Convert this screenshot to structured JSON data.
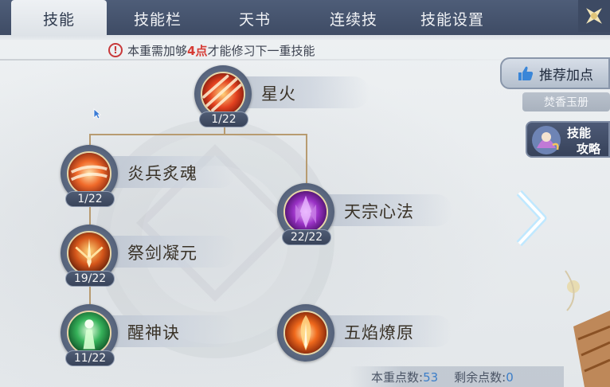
{
  "tabs": [
    {
      "label": "技能",
      "active": true
    },
    {
      "label": "技能栏",
      "active": false
    },
    {
      "label": "天书",
      "active": false
    },
    {
      "label": "连续技",
      "active": false
    },
    {
      "label": "技能设置",
      "active": false
    }
  ],
  "warning": {
    "prefix": "本重需加够",
    "highlight": "4点",
    "suffix": "才能修习下一重技能"
  },
  "skills": [
    {
      "name": "星火",
      "level": "1/22",
      "icon": "fire-slash-icon"
    },
    {
      "name": "炎兵炙魂",
      "level": "1/22",
      "icon": "flame-swirl-icon"
    },
    {
      "name": "天宗心法",
      "level": "22/22",
      "icon": "purple-crystal-icon"
    },
    {
      "name": "祭剑凝元",
      "level": "19/22",
      "icon": "sword-aura-icon"
    },
    {
      "name": "醒神诀",
      "level": "11/22",
      "icon": "green-spirit-icon"
    },
    {
      "name": "五焰燎原",
      "level": "",
      "icon": "fire-pillar-icon"
    }
  ],
  "right_panel": {
    "recommend_label": "推荐加点",
    "incense_label": "焚香玉册",
    "guide_line1": "技能",
    "guide_line2": "攻略"
  },
  "footer": {
    "current_label": "本重点数:",
    "current_value": "53",
    "remaining_label": "剩余点数:",
    "remaining_value": "0"
  },
  "colors": {
    "tabbar": "#4e5d78",
    "warning_highlight": "#d63b34",
    "connector": "#b79b71",
    "footer_number": "#3c7ec8"
  }
}
